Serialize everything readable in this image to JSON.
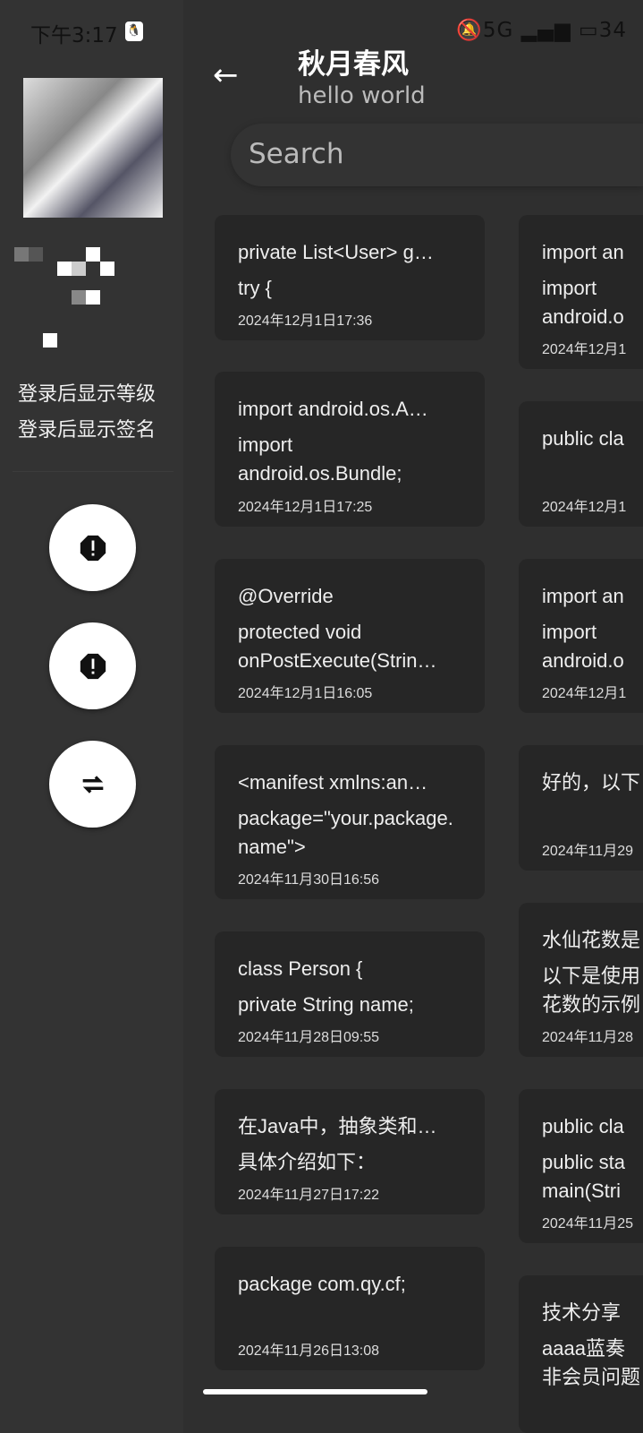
{
  "status": {
    "time": "下午3:17",
    "signal": "5G",
    "battery": "34"
  },
  "drawer": {
    "level_text": "登录后显示等级",
    "signature_text": "登录后显示签名",
    "buttons": [
      {
        "icon": "alert-icon"
      },
      {
        "icon": "alert-icon"
      },
      {
        "icon": "swap-icon"
      }
    ]
  },
  "header": {
    "title": "秋月春风",
    "subtitle": "hello world"
  },
  "search": {
    "placeholder": "Search"
  },
  "notes_left": [
    {
      "title": "private List<User> g…",
      "body": "try {",
      "date": "2024年12月1日17:36"
    },
    {
      "title": "import android.os.A…",
      "body": "import android.os.Bundle;",
      "date": "2024年12月1日17:25"
    },
    {
      "title": "@Override",
      "body": "protected void onPostExecute(Strin…",
      "date": "2024年12月1日16:05"
    },
    {
      "title": "<manifest xmlns:an…",
      "body": "package=\"your.package.name\">",
      "date": "2024年11月30日16:56"
    },
    {
      "title": "class Person {",
      "body": "private String name;",
      "date": "2024年11月28日09:55"
    },
    {
      "title": "在Java中，抽象类和…",
      "body": "具体介绍如下：",
      "date": "2024年11月27日17:22"
    },
    {
      "title": "package com.qy.cf;",
      "body": "",
      "date": "2024年11月26日13:08"
    }
  ],
  "notes_right": [
    {
      "title": "import an",
      "body": "import android.o",
      "date": "2024年12月1"
    },
    {
      "title": "public cla",
      "body": "",
      "date": "2024年12月1"
    },
    {
      "title": "import an",
      "body": "import android.o",
      "date": "2024年12月1"
    },
    {
      "title": "好的，以下",
      "body": "",
      "date": "2024年11月29"
    },
    {
      "title": "水仙花数是",
      "body": "以下是使用花数的示例",
      "date": "2024年11月28"
    },
    {
      "title": "public cla",
      "body": "public sta main(Stri",
      "date": "2024年11月25"
    },
    {
      "title": "技术分享",
      "body": "aaaa蓝奏非会员问题",
      "date": ""
    }
  ]
}
